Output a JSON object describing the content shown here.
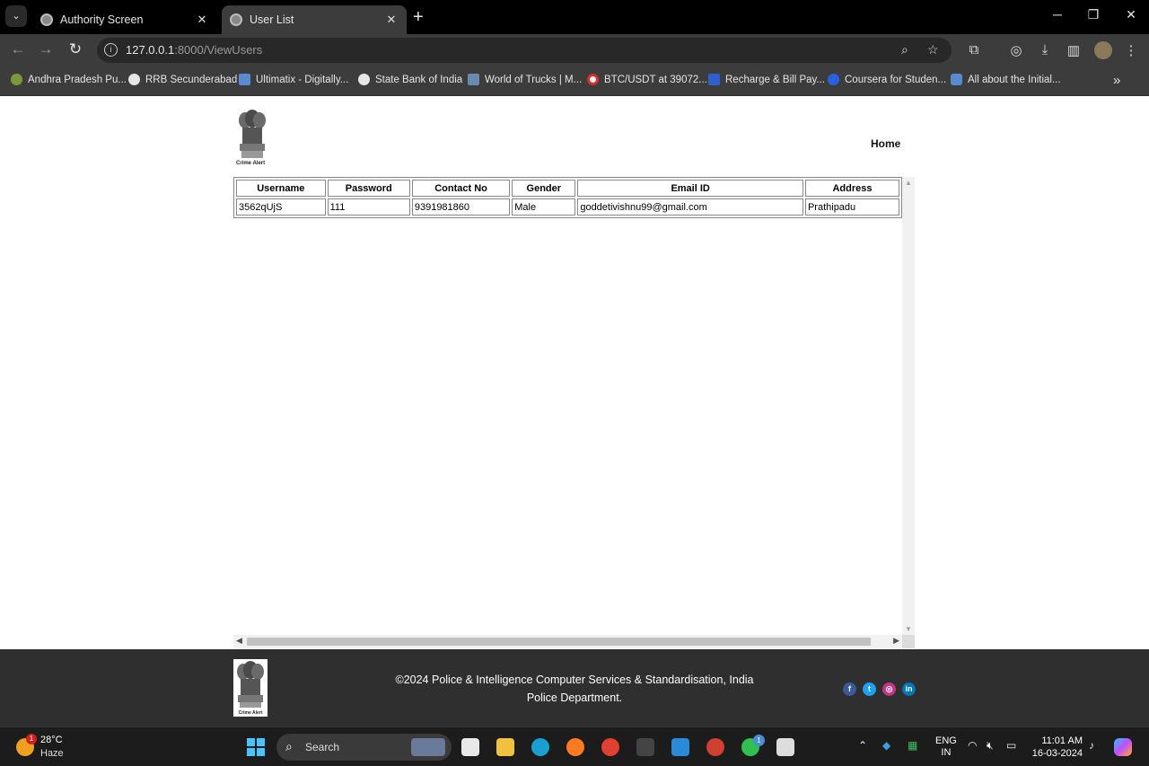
{
  "browser": {
    "tabs": [
      {
        "title": "Authority Screen"
      },
      {
        "title": "User List"
      }
    ],
    "address": {
      "host": "127.0.0.1",
      "rest": ":8000/ViewUsers"
    },
    "bookmarks": [
      {
        "label": "Andhra Pradesh Pu..."
      },
      {
        "label": "RRB Secunderabad"
      },
      {
        "label": "Ultimatix - Digitally..."
      },
      {
        "label": "State Bank of India"
      },
      {
        "label": "World of Trucks | M..."
      },
      {
        "label": "BTC/USDT at 39072...."
      },
      {
        "label": "Recharge & Bill Pay..."
      },
      {
        "label": "Coursera for Studen..."
      },
      {
        "label": "All about the Initial..."
      }
    ]
  },
  "page": {
    "logo_caption": "Crime Alert",
    "nav": {
      "home": "Home"
    },
    "table": {
      "headers": [
        "Username",
        "Password",
        "Contact No",
        "Gender",
        "Email ID",
        "Address"
      ],
      "rows": [
        [
          "3562qUjS",
          "111",
          "9391981860",
          "Male",
          "goddetivishnu99@gmail.com",
          "Prathipadu"
        ]
      ]
    }
  },
  "footer": {
    "logo_caption": "Crime Alert",
    "line1": "©2024 Police & Intelligence Computer Services & Standardisation, India",
    "line2": "Police Department.",
    "social": [
      "facebook-icon",
      "twitter-icon",
      "instagram-icon",
      "linkedin-icon"
    ]
  },
  "taskbar": {
    "weather": {
      "temp": "28°C",
      "condition": "Haze",
      "badge": "1"
    },
    "search_label": "Search",
    "whatsapp_badge": "1",
    "language": {
      "line1": "ENG",
      "line2": "IN"
    },
    "clock": {
      "time": "11:01 AM",
      "date": "16-03-2024"
    }
  }
}
